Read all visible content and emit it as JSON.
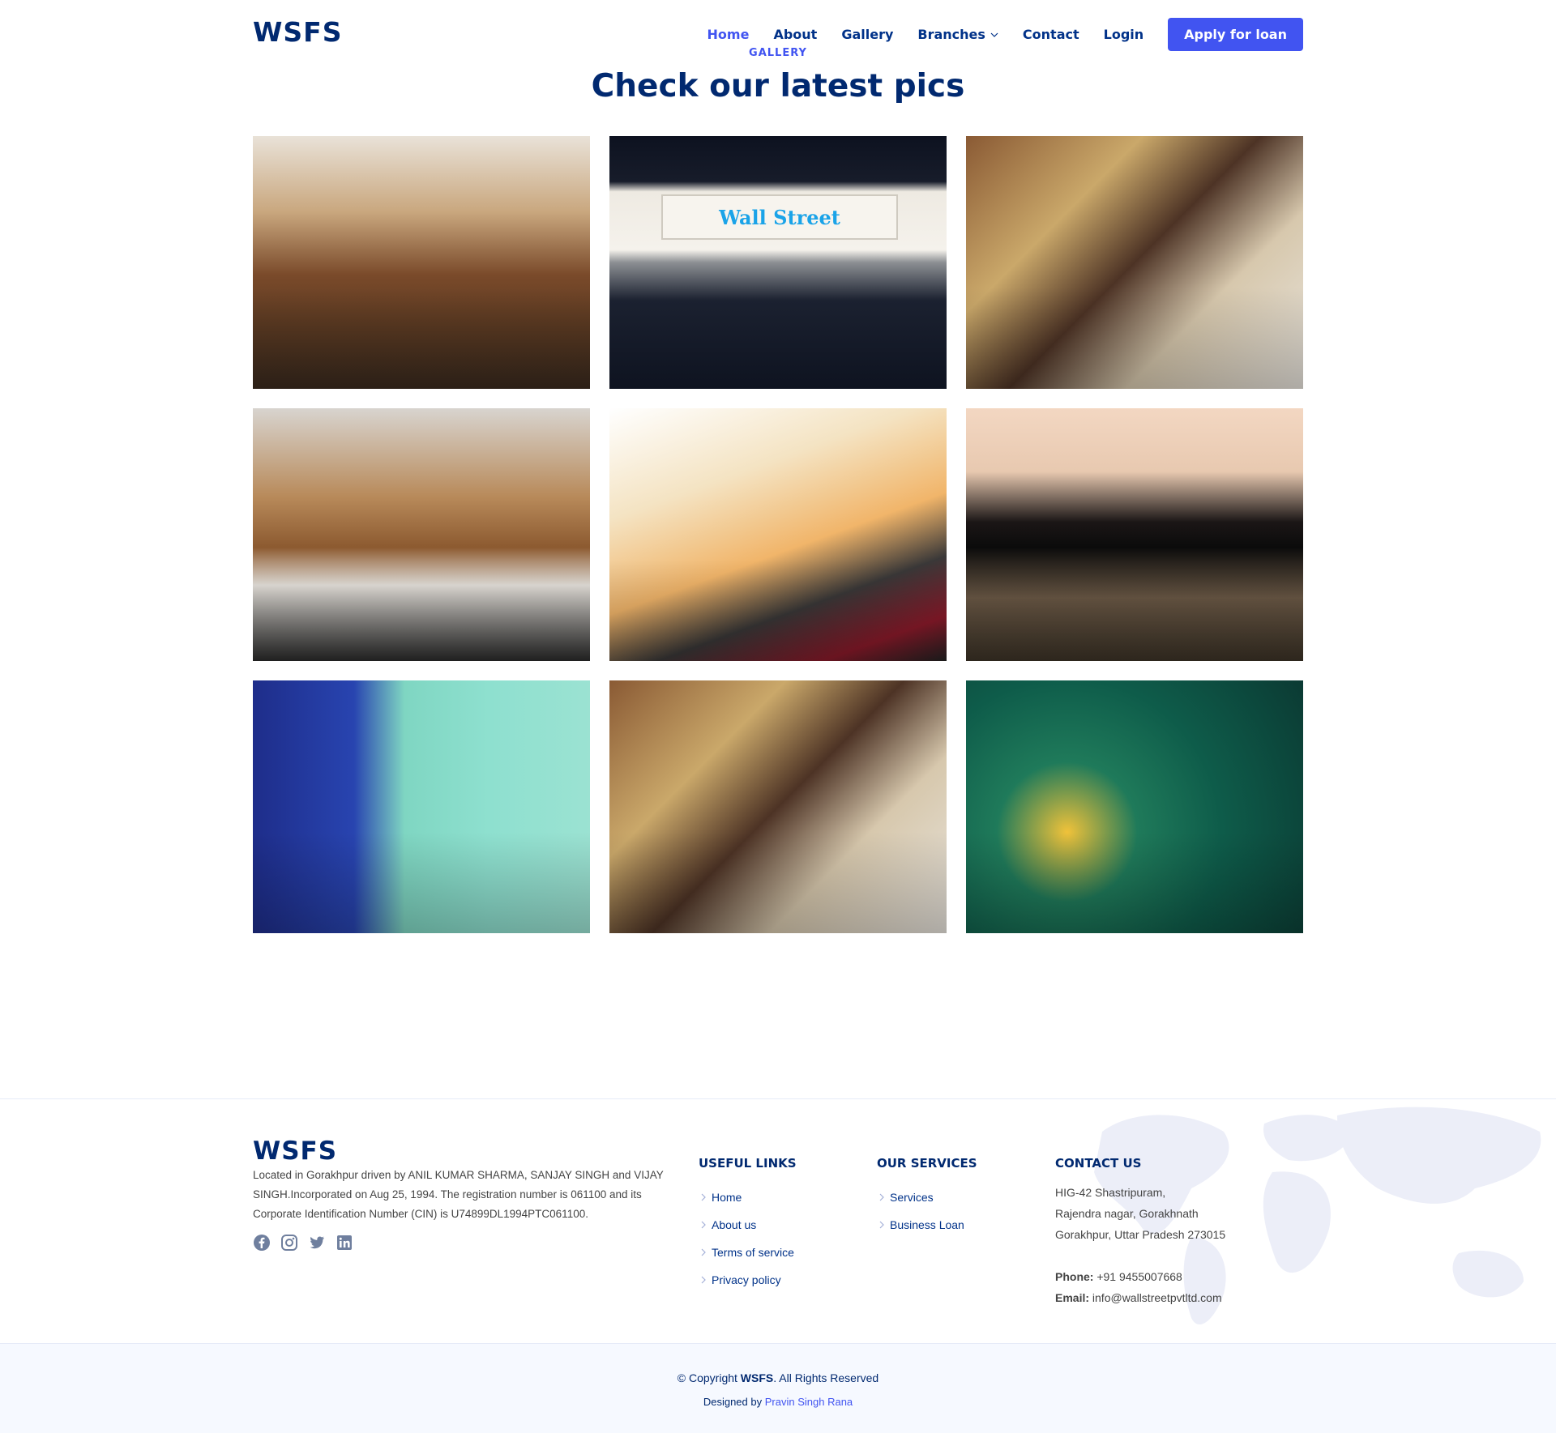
{
  "header": {
    "logo": "WSFS",
    "nav": {
      "home": "Home",
      "about": "About",
      "gallery": "Gallery",
      "branches": "Branches",
      "contact": "Contact",
      "login": "Login"
    },
    "apply_label": "Apply for loan"
  },
  "section": {
    "subtitle": "GALLERY",
    "title": "Check our latest pics"
  },
  "gallery": {
    "sign_text": "Wall Street"
  },
  "footer": {
    "logo": "WSFS",
    "about": "Located in Gorakhpur driven by ANIL KUMAR SHARMA, SANJAY SINGH and VIJAY SINGH.Incorporated on Aug 25, 1994. The registration number is 061100 and its Corporate Identification Number (CIN) is U74899DL1994PTC061100.",
    "useful_links": {
      "heading": "USEFUL LINKS",
      "items": [
        "Home",
        "About us",
        "Terms of service",
        "Privacy policy"
      ]
    },
    "services": {
      "heading": "OUR SERVICES",
      "items": [
        "Services",
        "Business Loan"
      ]
    },
    "contact": {
      "heading": "CONTACT US",
      "address_1": "HIG-42 Shastripuram,",
      "address_2": "Rajendra nagar, Gorakhnath",
      "address_3": "Gorakhpur, Uttar Pradesh 273015",
      "phone_label": "Phone:",
      "phone": "+91 9455007668",
      "email_label": "Email:",
      "email": "info@wallstreetpvtltd.com"
    },
    "copyright_prefix": "© Copyright",
    "copyright_brand": "WSFS",
    "copyright_suffix": ". All Rights Reserved",
    "designed_by_label": "Designed by",
    "designer": "Pravin Singh Rana"
  },
  "colors": {
    "primary": "#4154f1",
    "navy": "#012970",
    "footer_bg": "#f6f9ff"
  },
  "icons": {
    "social": [
      "facebook-icon",
      "instagram-icon",
      "twitter-icon",
      "linkedin-icon"
    ]
  }
}
